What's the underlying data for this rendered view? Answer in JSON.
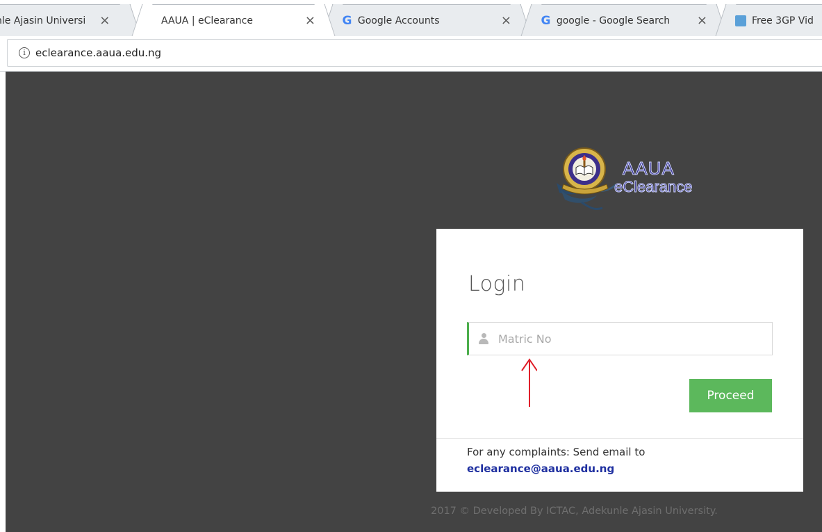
{
  "browser": {
    "tabs": [
      {
        "label": "nle Ajasin Universi",
        "icon": null
      },
      {
        "label": "AAUA | eClearance",
        "icon": null
      },
      {
        "label": "Google Accounts",
        "icon": "google-icon"
      },
      {
        "label": "google - Google Search",
        "icon": "google-icon"
      },
      {
        "label": "Free 3GP Vid",
        "icon": "image-icon"
      }
    ],
    "close_glyph": "×",
    "url": "eclearance.aaua.edu.ng"
  },
  "logo": {
    "title": "AAUA",
    "subtitle": "eClearance"
  },
  "login": {
    "title": "Login",
    "matric_placeholder": "Matric No",
    "proceed_label": "Proceed"
  },
  "complaints": {
    "text": "For any complaints: Send email to",
    "email": "eclearance@aaua.edu.ng"
  },
  "footer": {
    "text": "2017 © Developed By ICTAC, Adekunle Ajasin University."
  },
  "colors": {
    "page_background": "#434343",
    "accent_green": "#5cb85c",
    "link_blue": "#1e2fa0",
    "annotation_red": "#e0202a"
  }
}
